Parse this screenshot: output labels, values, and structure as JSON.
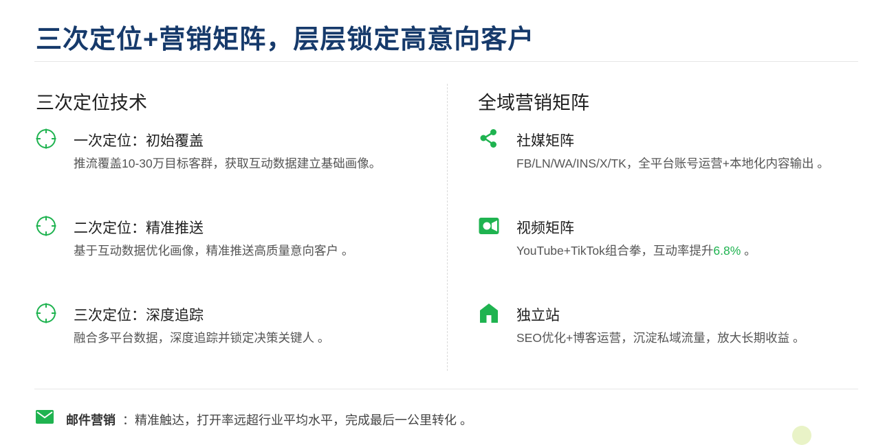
{
  "title": "三次定位+营销矩阵，层层锁定高意向客户",
  "colors": {
    "title": "#163a6b",
    "accent_green": "#1fb350",
    "text": "#1f1f1f",
    "muted": "#555555"
  },
  "left": {
    "title": "三次定位技术",
    "icon": "target-icon",
    "items": [
      {
        "title": "一次定位：初始覆盖",
        "desc": "推流覆盖10-30万目标客群，获取互动数据建立基础画像。"
      },
      {
        "title": "二次定位：精准推送",
        "desc": "基于互动数据优化画像，精准推送高质量意向客户 。"
      },
      {
        "title": "三次定位：深度追踪",
        "desc": "融合多平台数据，深度追踪并锁定决策关键人 。"
      }
    ]
  },
  "right": {
    "title": "全域营销矩阵",
    "items": [
      {
        "icon": "share-icon",
        "title": "社媒矩阵",
        "desc": "FB/LN/WA/INS/X/TK，全平台账号运营+本地化内容输出 。"
      },
      {
        "icon": "video-camera-icon",
        "title": "视频矩阵",
        "desc_pre": "YouTube+TikTok组合拳，互动率提升",
        "desc_highlight": "6.8%",
        "desc_post": " 。"
      },
      {
        "icon": "home-icon",
        "title": "独立站",
        "desc": "SEO优化+博客运营，沉淀私域流量，放大长期收益 。"
      }
    ]
  },
  "footer": {
    "icon": "mail-icon",
    "label": "邮件营销",
    "text": "：精准触达，打开率远超行业平均水平，完成最后一公里转化 。"
  }
}
